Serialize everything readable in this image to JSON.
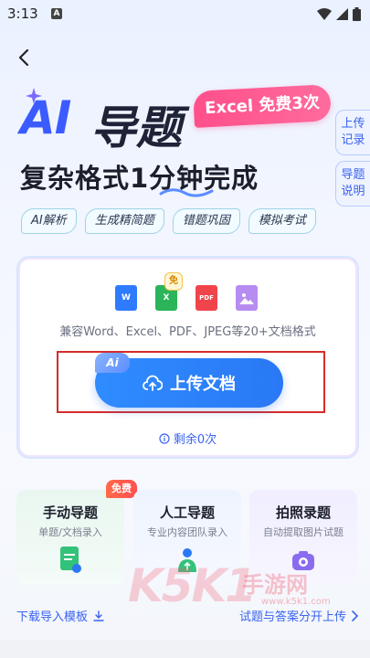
{
  "status_bar": {
    "time": "3:13",
    "notif_letter": "A"
  },
  "hero": {
    "title_ai": "AI",
    "title_rest": "导题",
    "excel_badge": "Excel 免费3次",
    "subtitle": "复杂格式1分钟完成"
  },
  "side_tabs": [
    {
      "label": "上传记录"
    },
    {
      "label": "导题说明"
    }
  ],
  "feature_tags": [
    "AI解析",
    "生成精简题",
    "错题巩固",
    "模拟考试"
  ],
  "upload_card": {
    "file_types": [
      "W",
      "X",
      "PDF",
      "IMG"
    ],
    "free_tag": "免",
    "formats_text": "兼容Word、Excel、PDF、JPEG等20+文档格式",
    "ai_chip": "Ai",
    "upload_button": "上传文档",
    "remaining": "剩余0次"
  },
  "options": [
    {
      "title": "手动导题",
      "desc": "单题/文档录入",
      "badge": "免费"
    },
    {
      "title": "人工导题",
      "desc": "专业内容团队录入"
    },
    {
      "title": "拍照录题",
      "desc": "自动提取图片试题"
    }
  ],
  "footer_links": {
    "download_template": "下载导入模板",
    "split_upload": "试题与答案分开上传"
  },
  "watermark": {
    "brand": "K5K1",
    "cn": "手游网",
    "url": "www.k5k1.com"
  },
  "colors": {
    "accent": "#3a63f0",
    "upload_button": "#2f8cff",
    "badge_pink": "#ff4f8b"
  }
}
